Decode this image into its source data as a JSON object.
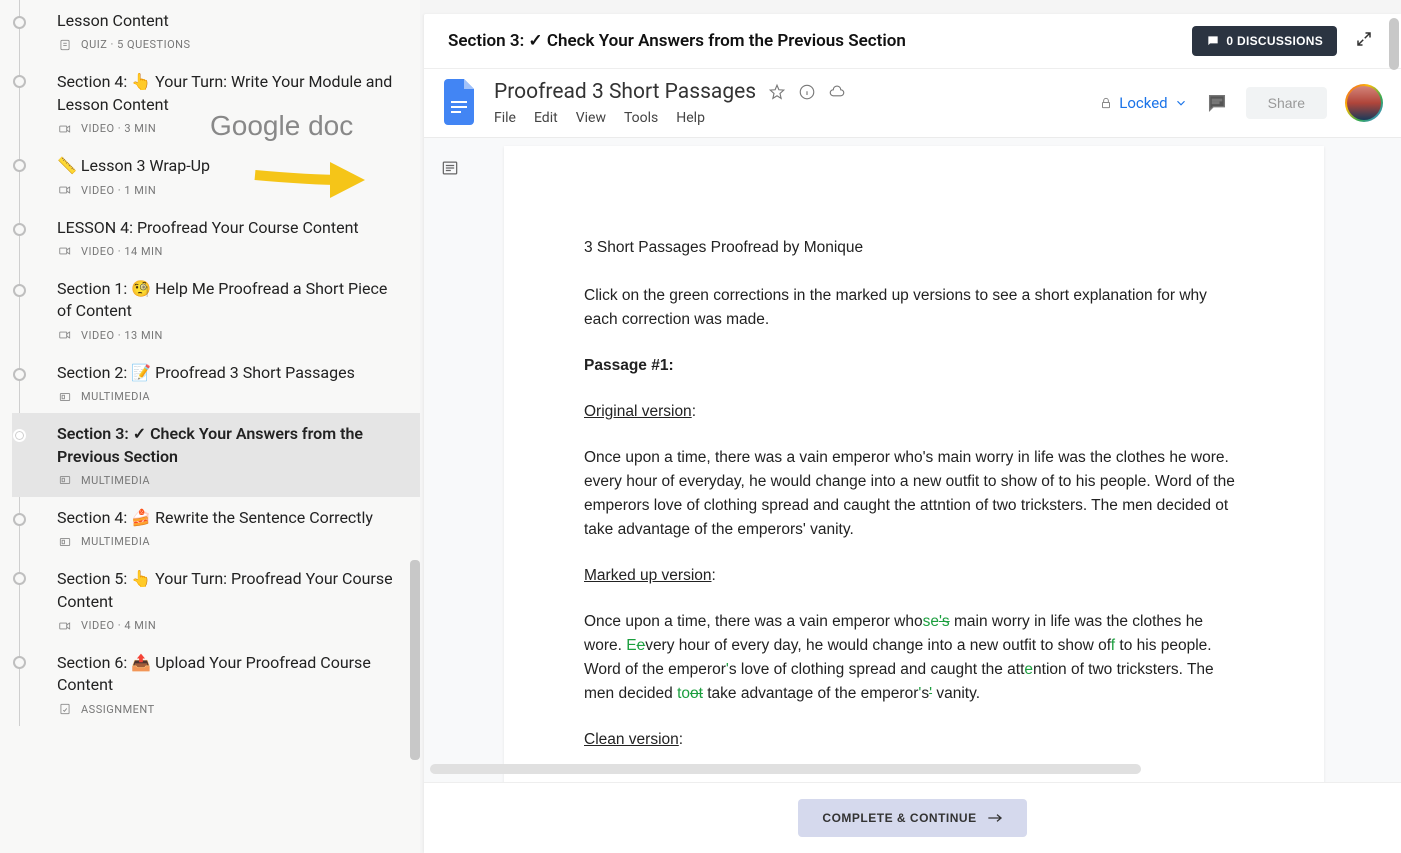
{
  "sidebar": {
    "items": [
      {
        "title": "Lesson Content",
        "meta": "QUIZ · 5 QUESTIONS",
        "icon": "quiz",
        "large": false
      },
      {
        "title": "Section 4: 👆 Your Turn: Write Your Module and Lesson Content",
        "meta": "VIDEO · 3 MIN",
        "icon": "video",
        "large": true
      },
      {
        "title": "📏 Lesson 3 Wrap-Up",
        "meta": "VIDEO · 1 MIN",
        "icon": "video",
        "large": true
      },
      {
        "title": "LESSON 4: Proofread Your Course Content",
        "meta": "VIDEO · 14 MIN",
        "icon": "video",
        "large": false
      },
      {
        "title": "Section 1: 🧐 Help Me Proofread a Short Piece of Content",
        "meta": "VIDEO · 13 MIN",
        "icon": "video",
        "large": false
      },
      {
        "title": "Section 2: 📝 Proofread 3 Short Passages",
        "meta": "MULTIMEDIA",
        "icon": "multimedia",
        "large": false
      },
      {
        "title": "Section 3: ✓ Check Your Answers from the Previous Section",
        "meta": "MULTIMEDIA",
        "icon": "multimedia",
        "large": false,
        "active": true
      },
      {
        "title": "Section 4: 🍰 Rewrite the Sentence Correctly",
        "meta": "MULTIMEDIA",
        "icon": "multimedia",
        "large": false
      },
      {
        "title": "Section 5: 👆 Your Turn: Proofread Your Course Content",
        "meta": "VIDEO · 4 MIN",
        "icon": "video",
        "large": true
      },
      {
        "title": "Section 6: 📤 Upload Your Proofread Course Content",
        "meta": "ASSIGNMENT",
        "icon": "assignment",
        "large": true
      }
    ]
  },
  "annotation": {
    "text": "Google doc"
  },
  "main": {
    "header_title": "Section 3: ✓ Check Your Answers from the Previous Section",
    "discussions_label": "0 DISCUSSIONS",
    "continue_label": "COMPLETE & CONTINUE"
  },
  "doc": {
    "title": "Proofread 3 Short Passages",
    "menus": [
      "File",
      "Edit",
      "View",
      "Tools",
      "Help"
    ],
    "locked_label": "Locked",
    "share_label": "Share",
    "body": {
      "heading": "3 Short Passages Proofread by Monique",
      "intro": "Click on the green corrections in the marked up versions to see a short explanation for why each correction was made.",
      "passage_label": "Passage #1:",
      "original_label": "Original version",
      "original_text": "Once upon a time, there was a vain emperor who's main worry in life was the clothes he wore. every hour of everyday, he would change into a new outfit to show of to his people. Word of the emperors love of clothing spread and caught the attntion of two tricksters. The men decided ot take advantage of the emperors' vanity.",
      "marked_label": "Marked up version",
      "marked": {
        "p1": "Once upon a time, there was a vain emperor who",
        "c1a": "se",
        "c1b": "'s",
        "p2": " main worry in life was the clothes he wore. ",
        "c2a": "E",
        "c2b": "e",
        "p3": "very hour of every",
        "sp": " ",
        "p3b": "day, he would change into a new outfit to show of",
        "c3": "f",
        "p4": " to his people. Word of the emperor",
        "c4": "'",
        "p5": "s love of clothing spread and caught the att",
        "c5": "e",
        "p6": "ntion of two tricksters. The men decided ",
        "c6a": "to",
        "c6b": "ot",
        "p7": " take advantage of the emperor",
        "c7": "'",
        "p8": "s",
        "c8": "'",
        "p9": " vanity."
      },
      "clean_label": "Clean version"
    }
  }
}
